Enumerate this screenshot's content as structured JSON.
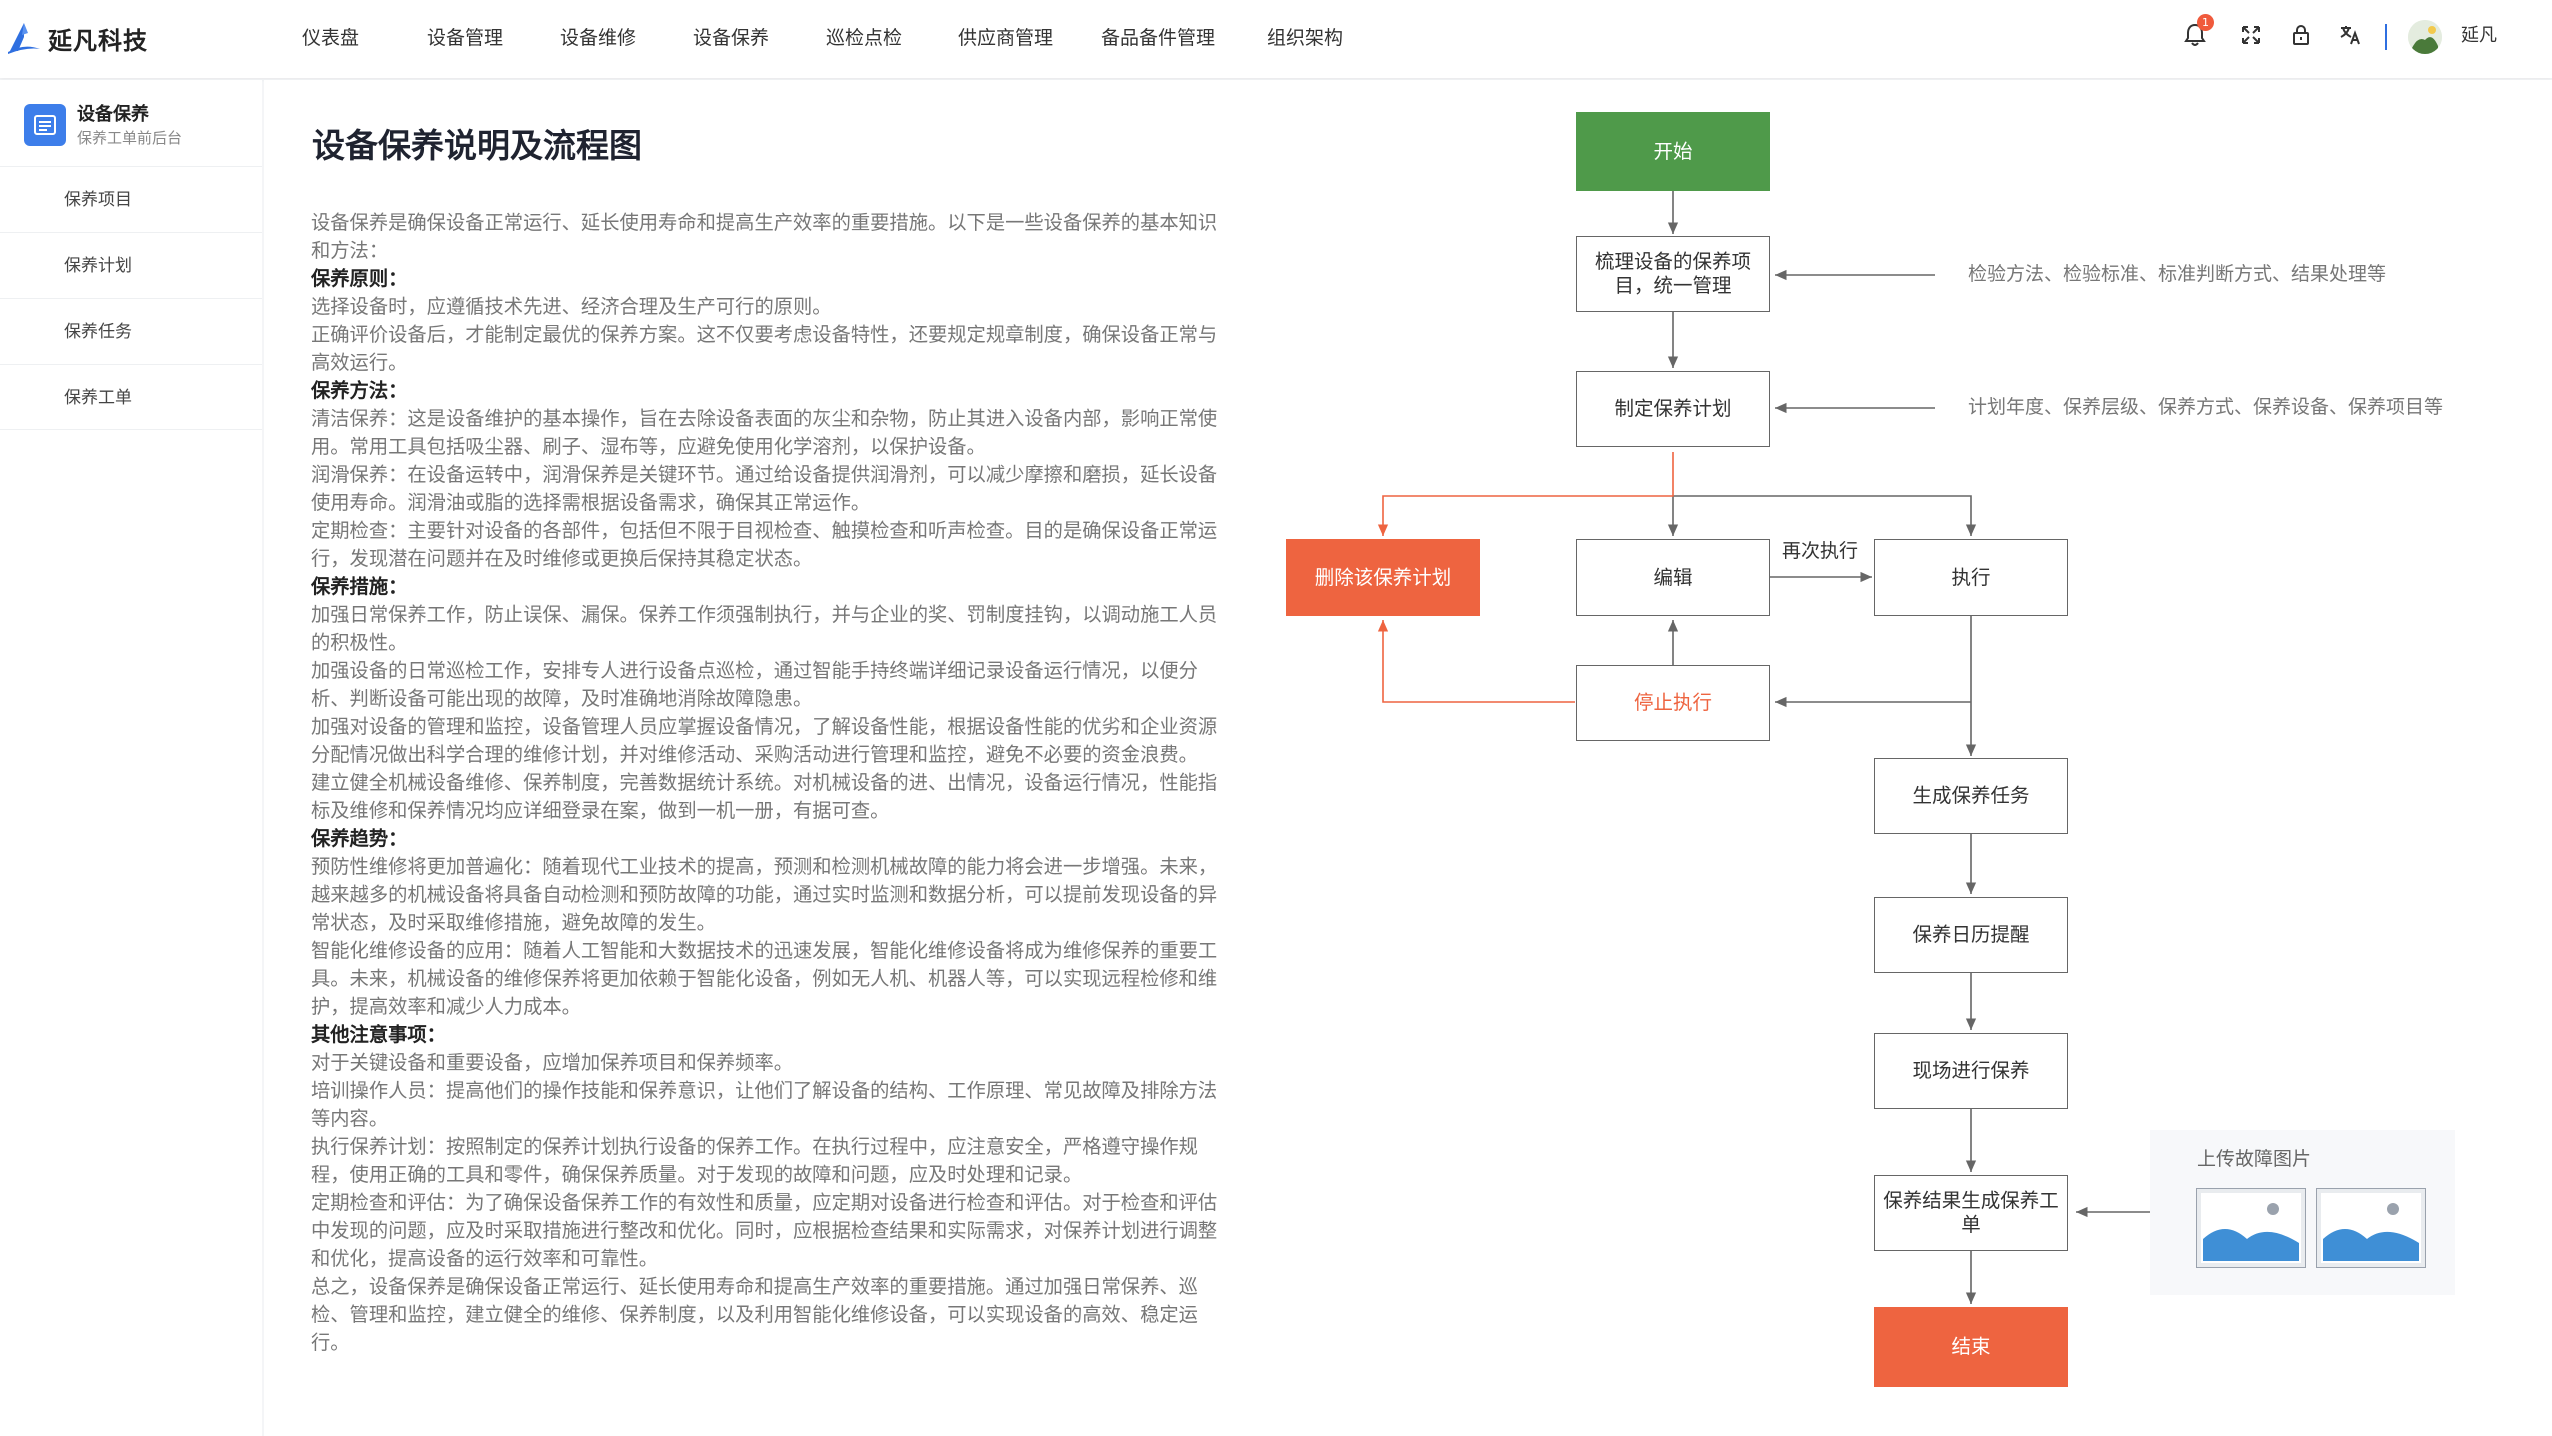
{
  "app": {
    "logo_text": "延凡科技",
    "username": "延凡",
    "notification_count": "1"
  },
  "nav": [
    "仪表盘",
    "设备管理",
    "设备维修",
    "设备保养",
    "巡检点检",
    "供应商管理",
    "备品备件管理",
    "组织架构"
  ],
  "sidebar": {
    "title": "设备保养",
    "subtitle": "保养工单前后台",
    "items": [
      "保养项目",
      "保养计划",
      "保养任务",
      "保养工单"
    ]
  },
  "page": {
    "title": "设备保养说明及流程图"
  },
  "doc": [
    {
      "t": "p",
      "text": "设备保养是确保设备正常运行、延长使用寿命和提高生产效率的重要措施。以下是一些设备保养的基本知识和方法："
    },
    {
      "t": "h",
      "text": "保养原则："
    },
    {
      "t": "p",
      "text": "选择设备时，应遵循技术先进、经济合理及生产可行的原则。"
    },
    {
      "t": "p",
      "text": "正确评价设备后，才能制定最优的保养方案。这不仅要考虑设备特性，还要规定规章制度，确保设备正常与高效运行。"
    },
    {
      "t": "h",
      "text": "保养方法："
    },
    {
      "t": "p",
      "text": "清洁保养：这是设备维护的基本操作，旨在去除设备表面的灰尘和杂物，防止其进入设备内部，影响正常使用。常用工具包括吸尘器、刷子、湿布等，应避免使用化学溶剂，以保护设备。"
    },
    {
      "t": "p",
      "text": "润滑保养：在设备运转中，润滑保养是关键环节。通过给设备提供润滑剂，可以减少摩擦和磨损，延长设备使用寿命。润滑油或脂的选择需根据设备需求，确保其正常运作。"
    },
    {
      "t": "p",
      "text": "定期检查：主要针对设备的各部件，包括但不限于目视检查、触摸检查和听声检查。目的是确保设备正常运行，发现潜在问题并在及时维修或更换后保持其稳定状态。"
    },
    {
      "t": "h",
      "text": "保养措施："
    },
    {
      "t": "p",
      "text": "加强日常保养工作，防止误保、漏保。保养工作须强制执行，并与企业的奖、罚制度挂钩，以调动施工人员的积极性。"
    },
    {
      "t": "p",
      "text": "加强设备的日常巡检工作，安排专人进行设备点巡检，通过智能手持终端详细记录设备运行情况，以便分析、判断设备可能出现的故障，及时准确地消除故障隐患。"
    },
    {
      "t": "p",
      "text": "加强对设备的管理和监控，设备管理人员应掌握设备情况，了解设备性能，根据设备性能的优劣和企业资源分配情况做出科学合理的维修计划，并对维修活动、采购活动进行管理和监控，避免不必要的资金浪费。"
    },
    {
      "t": "p",
      "text": "建立健全机械设备维修、保养制度，完善数据统计系统。对机械设备的进、出情况，设备运行情况，性能指标及维修和保养情况均应详细登录在案，做到一机一册，有据可查。"
    },
    {
      "t": "h",
      "text": "保养趋势："
    },
    {
      "t": "p",
      "text": "预防性维修将更加普遍化：随着现代工业技术的提高，预测和检测机械故障的能力将会进一步增强。未来，越来越多的机械设备将具备自动检测和预防故障的功能，通过实时监测和数据分析，可以提前发现设备的异常状态，及时采取维修措施，避免故障的发生。"
    },
    {
      "t": "p",
      "text": "智能化维修设备的应用：随着人工智能和大数据技术的迅速发展，智能化维修设备将成为维修保养的重要工具。未来，机械设备的维修保养将更加依赖于智能化设备，例如无人机、机器人等，可以实现远程检修和维护，提高效率和减少人力成本。"
    },
    {
      "t": "h",
      "text": "其他注意事项："
    },
    {
      "t": "p",
      "text": "对于关键设备和重要设备，应增加保养项目和保养频率。"
    },
    {
      "t": "p",
      "text": "培训操作人员：提高他们的操作技能和保养意识，让他们了解设备的结构、工作原理、常见故障及排除方法等内容。"
    },
    {
      "t": "p",
      "text": "执行保养计划：按照制定的保养计划执行设备的保养工作。在执行过程中，应注意安全，严格遵守操作规程，使用正确的工具和零件，确保保养质量。对于发现的故障和问题，应及时处理和记录。"
    },
    {
      "t": "p",
      "text": "定期检查和评估：为了确保设备保养工作的有效性和质量，应定期对设备进行检查和评估。对于检查和评估中发现的问题，应及时采取措施进行整改和优化。同时，应根据检查结果和实际需求，对保养计划进行调整和优化，提高设备的运行效率和可靠性。"
    },
    {
      "t": "p",
      "text": "总之，设备保养是确保设备正常运行、延长使用寿命和提高生产效率的重要措施。通过加强日常保养、巡检、管理和监控，建立健全的维修、保养制度，以及利用智能化维修设备，可以实现设备的高效、稳定运行。"
    }
  ],
  "flow": {
    "nodes": {
      "start": "开始",
      "sort": "梳理设备的保养项目，统一管理",
      "plan": "制定保养计划",
      "delete": "删除该保养计划",
      "edit": "编辑",
      "execute": "执行",
      "stop": "停止执行",
      "gen_task": "生成保养任务",
      "calendar": "保养日历提醒",
      "onsite": "现场进行保养",
      "result": "保养结果生成保养工单",
      "end": "结束"
    },
    "notes": {
      "sort_note": "检验方法、检验标准、标准判断方式、结果处理等",
      "plan_note": "计划年度、保养层级、保养方式、保养设备、保养项目等",
      "reexec": "再次执行",
      "upload": "上传故障图片"
    }
  },
  "colors": {
    "accent": "#3d7eea",
    "green": "#4f9a4a",
    "red": "#ee6440"
  }
}
